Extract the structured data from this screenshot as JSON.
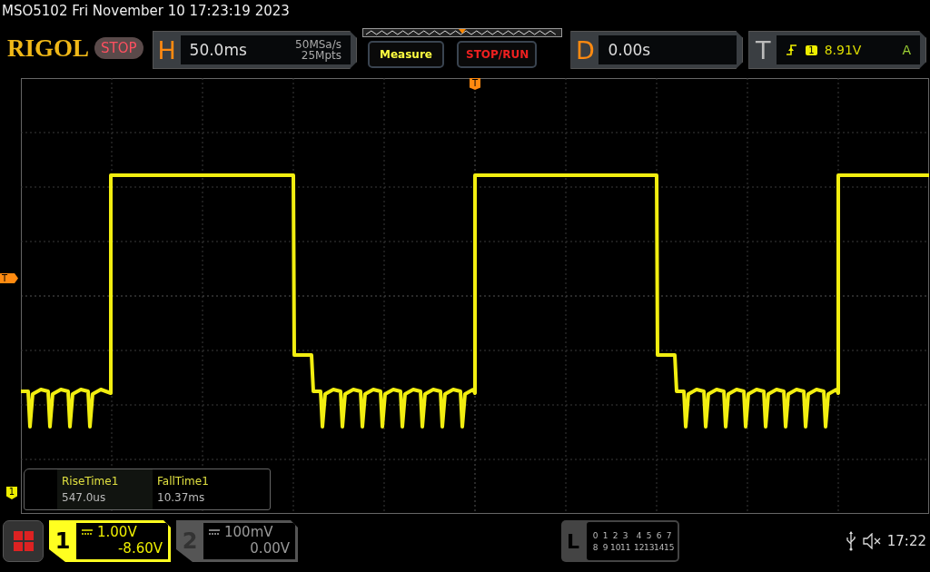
{
  "header": {
    "title": "MSO5102  Fri November 10 17:23:19 2023"
  },
  "toolbar": {
    "logo": "RIGOL",
    "run_state": "STOP",
    "horizontal": {
      "label": "H",
      "timebase": "50.0ms",
      "sample_rate": "50MSa/s",
      "memory": "25Mpts"
    },
    "buttons": [
      {
        "label": "Measure",
        "kind": "measure"
      },
      {
        "label": "STOP/RUN",
        "kind": "run"
      }
    ],
    "delay": {
      "label": "D",
      "value": "0.00s"
    },
    "trigger": {
      "label": "T",
      "source": "1",
      "level": "8.91V",
      "mode": "A"
    }
  },
  "grid": {
    "trigger_position_marker": "T",
    "trigger_level_marker": "T",
    "channel_marker": "1",
    "measurements": [
      {
        "name": "RiseTime1",
        "value": "547.0us"
      },
      {
        "name": "FallTime1",
        "value": "10.37ms"
      }
    ]
  },
  "bottom_bar": {
    "channels": [
      {
        "number": "1",
        "scale": "1.00V",
        "offset": "-8.60V",
        "selected": true
      },
      {
        "number": "2",
        "scale": "100mV",
        "offset": "0.00V",
        "selected": false
      }
    ],
    "logic": {
      "label": "L",
      "rows": [
        [
          "0",
          "1",
          "2",
          "3",
          "4",
          "5",
          "6",
          "7"
        ],
        [
          "8",
          "9",
          "10",
          "11",
          "12",
          "13",
          "14",
          "15"
        ]
      ]
    },
    "time": "17:22"
  }
}
